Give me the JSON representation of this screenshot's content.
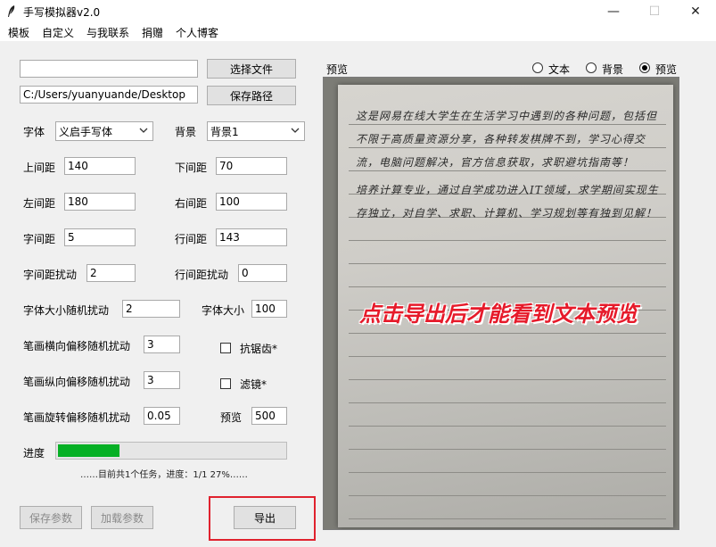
{
  "window": {
    "title": "手写模拟器v2.0",
    "min_glyph": "—",
    "max_glyph": "☐",
    "close_glyph": "✕"
  },
  "menu": [
    "模板",
    "自定义",
    "与我联系",
    "捐赠",
    "个人博客"
  ],
  "file": {
    "path_value": "",
    "choose_file_label": "选择文件",
    "save_path_value": "C:/Users/yuanyuande/Desktop",
    "save_path_label": "保存路径"
  },
  "font": {
    "label": "字体",
    "value": "义启手写体"
  },
  "background": {
    "label": "背景",
    "value": "背景1"
  },
  "fields": {
    "top_margin": {
      "label": "上间距",
      "value": "140"
    },
    "bottom_margin": {
      "label": "下间距",
      "value": "70"
    },
    "left_margin": {
      "label": "左间距",
      "value": "180"
    },
    "right_margin": {
      "label": "右间距",
      "value": "100"
    },
    "char_spacing": {
      "label": "字间距",
      "value": "5"
    },
    "line_spacing": {
      "label": "行间距",
      "value": "143"
    },
    "char_spacing_jitter": {
      "label": "字间距扰动",
      "value": "2"
    },
    "line_spacing_jitter": {
      "label": "行间距扰动",
      "value": "0"
    },
    "font_size_jitter": {
      "label": "字体大小随机扰动",
      "value": "2"
    },
    "font_size": {
      "label": "字体大小",
      "value": "100"
    },
    "stroke_h_jitter": {
      "label": "笔画横向偏移随机扰动",
      "value": "3"
    },
    "stroke_v_jitter": {
      "label": "笔画纵向偏移随机扰动",
      "value": "3"
    },
    "stroke_rot_jitter": {
      "label": "笔画旋转偏移随机扰动",
      "value": "0.05"
    },
    "preview": {
      "label": "预览",
      "value": "500"
    }
  },
  "checkboxes": {
    "antialias": {
      "label": "抗锯齿*",
      "checked": false
    },
    "filter": {
      "label": "滤镜*",
      "checked": false
    }
  },
  "progress": {
    "label": "进度",
    "fraction": 0.27,
    "status": "……目前共1个任务，进度：1/1 27%……"
  },
  "buttons": {
    "save_params": "保存参数",
    "load_params": "加载参数",
    "export": "导出"
  },
  "preview_panel": {
    "title": "预览",
    "modes": [
      {
        "label": "文本",
        "selected": false
      },
      {
        "label": "背景",
        "selected": false
      },
      {
        "label": "预览",
        "selected": true
      }
    ],
    "paragraph1": "这是网易在线大学生在生活学习中遇到的各种问题，包括但不限于高质量资源分享，各种转发棋牌不到，学习心得交流，电脑问题解决，官方信息获取，求职避坑指南等！",
    "paragraph2": "培养计算专业，通过自学成功进入IT领域，求学期间实现生存独立，对自学、求职、计算机、学习规划等有独到见解！",
    "overlay_text": "点击导出后才能看到文本预览"
  },
  "colors": {
    "progress_fill": "#06b025",
    "overlay_red": "#e61a2a",
    "highlight_box": "#e0222e"
  }
}
